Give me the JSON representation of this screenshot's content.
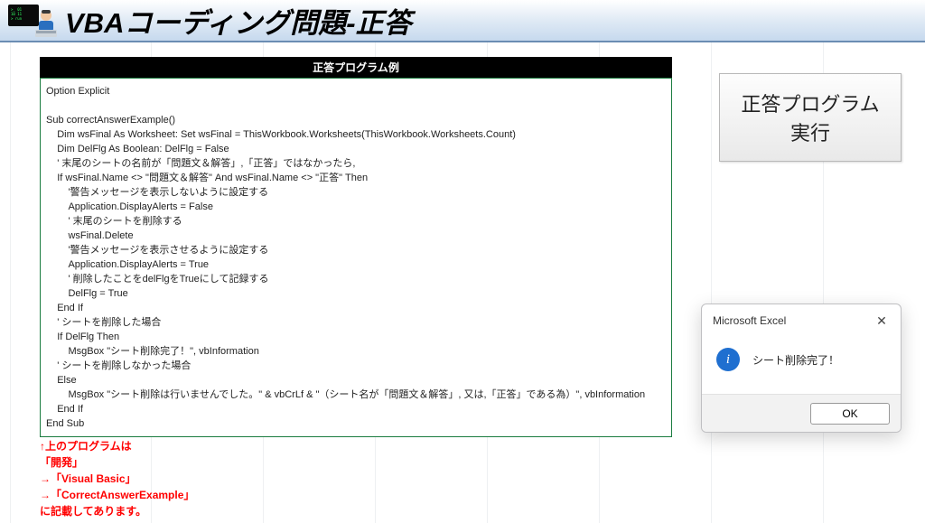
{
  "header": {
    "title": "VBAコーディング問題-正答",
    "icon": "programmer-icon"
  },
  "codebox": {
    "title": "正答プログラム例",
    "code": "Option Explicit\n\nSub correctAnswerExample()\n    Dim wsFinal As Worksheet: Set wsFinal = ThisWorkbook.Worksheets(ThisWorkbook.Worksheets.Count)\n    Dim DelFlg As Boolean: DelFlg = False\n    ' 末尾のシートの名前が「問題文＆解答」,「正答」ではなかったら,\n    If wsFinal.Name <> \"問題文＆解答\" And wsFinal.Name <> \"正答\" Then\n        '警告メッセージを表示しないように設定する\n        Application.DisplayAlerts = False\n        ' 末尾のシートを削除する\n        wsFinal.Delete\n        '警告メッセージを表示させるように設定する\n        Application.DisplayAlerts = True\n        ' 削除したことをdelFlgをTrueにして記録する\n        DelFlg = True\n    End If\n    ' シートを削除した場合\n    If DelFlg Then\n        MsgBox \"シート削除完了！\", vbInformation\n    ' シートを削除しなかった場合\n    Else\n        MsgBox \"シート削除は行いませんでした。\" & vbCrLf & \"（シート名が「問題文＆解答」, 又は,「正答」である為）\", vbInformation\n    End If\nEnd Sub"
  },
  "instructions": {
    "lines": [
      "↑上のプログラムは",
      "「開発」",
      "→「Visual Basic」",
      "→「CorrectAnswerExample」",
      "に記載してあります。"
    ]
  },
  "run_button": {
    "label": "正答プログラム\n実行"
  },
  "msgbox": {
    "title": "Microsoft Excel",
    "text": "シート削除完了！",
    "ok": "OK",
    "icon": "info-icon",
    "close_icon": "close-icon"
  }
}
